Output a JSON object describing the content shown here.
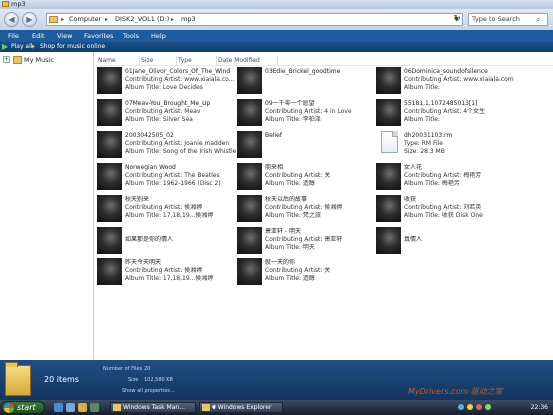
{
  "title_bar": {
    "title": "mp3"
  },
  "address": {
    "crumbs": [
      "Computer",
      "DISK2_VOL1 (D:)",
      "mp3"
    ],
    "search_placeholder": "Type to Search"
  },
  "menu": [
    "File",
    "Edit",
    "View",
    "Favorites",
    "Tools",
    "Help"
  ],
  "command_bar": {
    "play_all": "Play all",
    "shop": "Shop for music online"
  },
  "navigation": {
    "items": [
      {
        "label": "My Music"
      }
    ]
  },
  "columns": [
    "Name",
    "Size",
    "Type",
    "Date Modified"
  ],
  "files": [
    {
      "name": "01Jane_Olivor_Colors_Of_The_Wind",
      "line2": "Contributing Artist: www.xiaiala.co...",
      "line3": "Album Title: Love Decides",
      "kind": "music"
    },
    {
      "name": "03Edie_Brickel_goodtime",
      "line2": "",
      "line3": "",
      "kind": "music"
    },
    {
      "name": "06Dominica_soundofsilence",
      "line2": "Contributing Artist: www.xiaiala.com",
      "line3": "Album Title:",
      "kind": "music"
    },
    {
      "name": "07Meav-You_Brought_Me_Up",
      "line2": "Contributing Artist: Meav",
      "line3": "Album Title: Silver Sea",
      "kind": "music"
    },
    {
      "name": "09一千零一个愿望",
      "line2": "Contributing Artist: 4 in Love",
      "line3": "Album Title: 李柏泽",
      "kind": "music"
    },
    {
      "name": "55181,1,1072485013[1]",
      "line2": "Contributing Artist: 4个女生",
      "line3": "Album Title:",
      "kind": "music"
    },
    {
      "name": "2003042505_02",
      "line2": "Contributing Artist: Joanie madden",
      "line3": "Album Title: Song of the Irish Whistle",
      "kind": "music"
    },
    {
      "name": "Belief",
      "line2": "",
      "line3": "",
      "kind": "music"
    },
    {
      "name": "dh20031103.rm",
      "line2": "Type: RM File",
      "line3": "Size: 28.3 MB",
      "kind": "doc"
    },
    {
      "name": "Norwegian Wood",
      "line2": "Contributing Artist: The Beatles",
      "line3": "Album Title: 1962-1966 (Disc 2)",
      "kind": "music"
    },
    {
      "name": "朋来相",
      "line2": "Contributing Artist: 关",
      "line3": "Album Title: 造醇",
      "kind": "music"
    },
    {
      "name": "女人花",
      "line2": "Contributing Artist: 梅艳芳",
      "line3": "Album Title: 梅艳芳",
      "kind": "music"
    },
    {
      "name": "秋天别来",
      "line2": "Contributing Artist: 侯湘婷",
      "line3": "Album Title: 17,18,19...侯湘婷",
      "kind": "music"
    },
    {
      "name": "秋天以后的故事",
      "line2": "Contributing Artist: 侯湘婷",
      "line3": "Album Title: 梵之旅",
      "kind": "music"
    },
    {
      "name": "收获",
      "line2": "Contributing Artist: 刘若英",
      "line3": "Album Title: 收获 Disk One",
      "kind": "music"
    },
    {
      "name": "如果那是你的情人",
      "line2": "",
      "line3": "",
      "kind": "music"
    },
    {
      "name": "萧亚轩 - 明天",
      "line2": "Contributing Artist: 萧亚轩",
      "line3": "Album Title: 明天",
      "kind": "music"
    },
    {
      "name": "真情人",
      "line2": "",
      "line3": "",
      "kind": "music"
    },
    {
      "name": "昨天今天明天",
      "line2": "Contributing Artist: 侯湘婷",
      "line3": "Album Title: 17,18,19...侯湘婷",
      "kind": "music"
    },
    {
      "name": "就一天的你",
      "line2": "Contributing Artist: 关",
      "line3": "Album Title: 造醇",
      "kind": "music"
    }
  ],
  "details": {
    "count": "20 items",
    "number_label": "Number of Files",
    "number_value": "20",
    "size_label": "Size",
    "size_value": "102,580 KB",
    "show_properties": "Show all properties..."
  },
  "taskbar": {
    "start": "start",
    "buttons": [
      "Windows Task Man...",
      "4 Windows Explorer"
    ],
    "time": "22:36"
  },
  "watermark": "MyDrivers.com 驱动之家"
}
